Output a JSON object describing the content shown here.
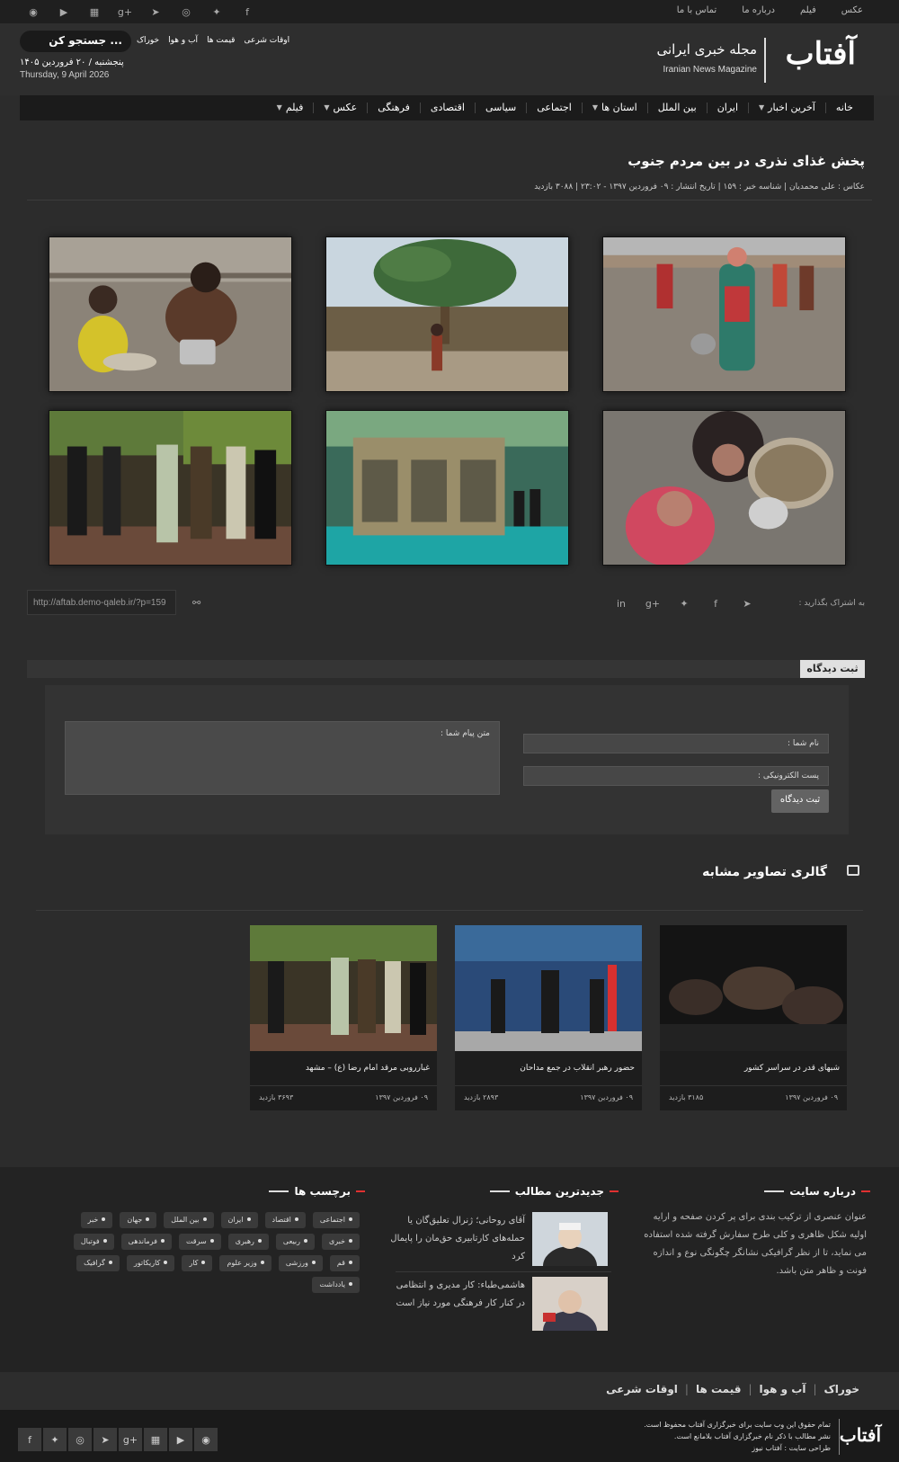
{
  "topbar": {
    "links": [
      "عکس",
      "فیلم",
      "درباره ما",
      "تماس با ما"
    ],
    "social_icons": [
      "facebook-icon",
      "twitter-icon",
      "instagram-icon",
      "telegram-icon",
      "google-plus-icon",
      "windows-icon",
      "youtube-icon",
      "rss-icon"
    ]
  },
  "header": {
    "logo": "آفتاب",
    "magazine_fa": "مجله خبری ایرانی",
    "magazine_en": "Iranian News Magazine",
    "search_placeholder": "جستجو کن ...",
    "quick_links": [
      "اوقات شرعی",
      "قیمت ها",
      "آب و هوا",
      "خوراک"
    ],
    "date_fa": "پنجشنبه / ۲۰ فروردین ۱۴۰۵",
    "date_en": "Thursday, 9 April  2026"
  },
  "nav": {
    "items": [
      {
        "label": "خانه",
        "dropdown": false
      },
      {
        "label": "آخرین اخبار",
        "dropdown": true
      },
      {
        "label": "ایران",
        "dropdown": false
      },
      {
        "label": "بین الملل",
        "dropdown": false
      },
      {
        "label": "استان ها",
        "dropdown": true
      },
      {
        "label": "اجتماعی",
        "dropdown": false
      },
      {
        "label": "سیاسی",
        "dropdown": false
      },
      {
        "label": "اقتصادی",
        "dropdown": false
      },
      {
        "label": "فرهنگی",
        "dropdown": false
      },
      {
        "label": "عکس",
        "dropdown": true
      },
      {
        "label": "فیلم",
        "dropdown": true
      }
    ]
  },
  "article": {
    "title": "پخش غذای نذری در بین مردم جنوب",
    "meta": "عکاس : علی محمدیان | شناسه خبر : ۱۵۹ | تاریخ انتشار : ۰۹ فروردین ۱۳۹۷ - ۲۳:۰۲ | ۳۰۸۸ بازدید"
  },
  "share": {
    "label": "به اشتراک بگذارید :",
    "icons": [
      "telegram-icon",
      "facebook-icon",
      "twitter-icon",
      "google-plus-icon",
      "linkedin-icon"
    ],
    "url": "http://aftab.demo-qaleb.ir/?p=159"
  },
  "comment": {
    "title": "ثبت دیدگاه",
    "message_placeholder": "متن پیام شما :",
    "name_placeholder": "نام شما :",
    "email_placeholder": "پست الکترونیکی :",
    "submit_label": "ثبت دیدگاه"
  },
  "similar": {
    "title": "گالری تصاویر مشابه",
    "cards": [
      {
        "title": "شبهای قدر در سراسر کشور",
        "date": "۰۹ فروردین ۱۳۹۷",
        "views": "۳۱۸۵ بازدید"
      },
      {
        "title": "حضور رهبر انقلاب در جمع مداحان",
        "date": "۰۹ فروردین ۱۳۹۷",
        "views": "۲۸۹۳ بازدید"
      },
      {
        "title": "غبارروبی مرقد امام رضا (ع) – مشهد",
        "date": "۰۹ فروردین ۱۳۹۷",
        "views": "۳۶۹۳ بازدید"
      }
    ]
  },
  "footer": {
    "about_title": "درباره سایت",
    "about_text": "عنوان عنصری از ترکیب بندی برای پر کردن صفحه و ارایه اولیه شکل ظاهری و کلی طرح سفارش گرفته شده استفاده می نماید، تا از نظر گرافیکی نشانگر چگونگی نوع و اندازه فونت و ظاهر متن باشد.",
    "news_title": "جدیدترین مطالب",
    "news": [
      {
        "text": "آقای روحانی؛ ژنرال تعلیق‌گان یا حمله‌های کارتابیری حق‌مان را پایمال کرد"
      },
      {
        "text": "هاشمی‌طباء: کار مدیری و انتظامی در کنار کار فرهنگی مورد نیاز است"
      }
    ],
    "tags_title": "برچسب ها",
    "tags": [
      "اجتماعی",
      "اقتصاد",
      "ایران",
      "بین الملل",
      "جهان",
      "خبر",
      "خبری",
      "ربیعی",
      "رهبری",
      "سرقت",
      "فرماندهی",
      "فوتبال",
      "قم",
      "ورزشی",
      "وزیر علوم",
      "کار",
      "کاریکاتور",
      "گرافیک",
      "یادداشت"
    ],
    "links": [
      "خوراک",
      "آب و هوا",
      "قیمت ها",
      "اوقات شرعی"
    ],
    "bottom_logo": "آفتاب",
    "copyright": [
      "تمام حقوق این وب سایت برای خبرگزاری آفتاب محفوظ است.",
      "نشر مطالب با ذکر نام خبرگزاری آفتاب بلامانع است.",
      "طراحی سایت : آفتاب نیوز"
    ],
    "social_icons": [
      "rss-icon",
      "youtube-icon",
      "windows-icon",
      "google-plus-icon",
      "telegram-icon",
      "instagram-icon",
      "twitter-icon",
      "facebook-icon"
    ]
  }
}
